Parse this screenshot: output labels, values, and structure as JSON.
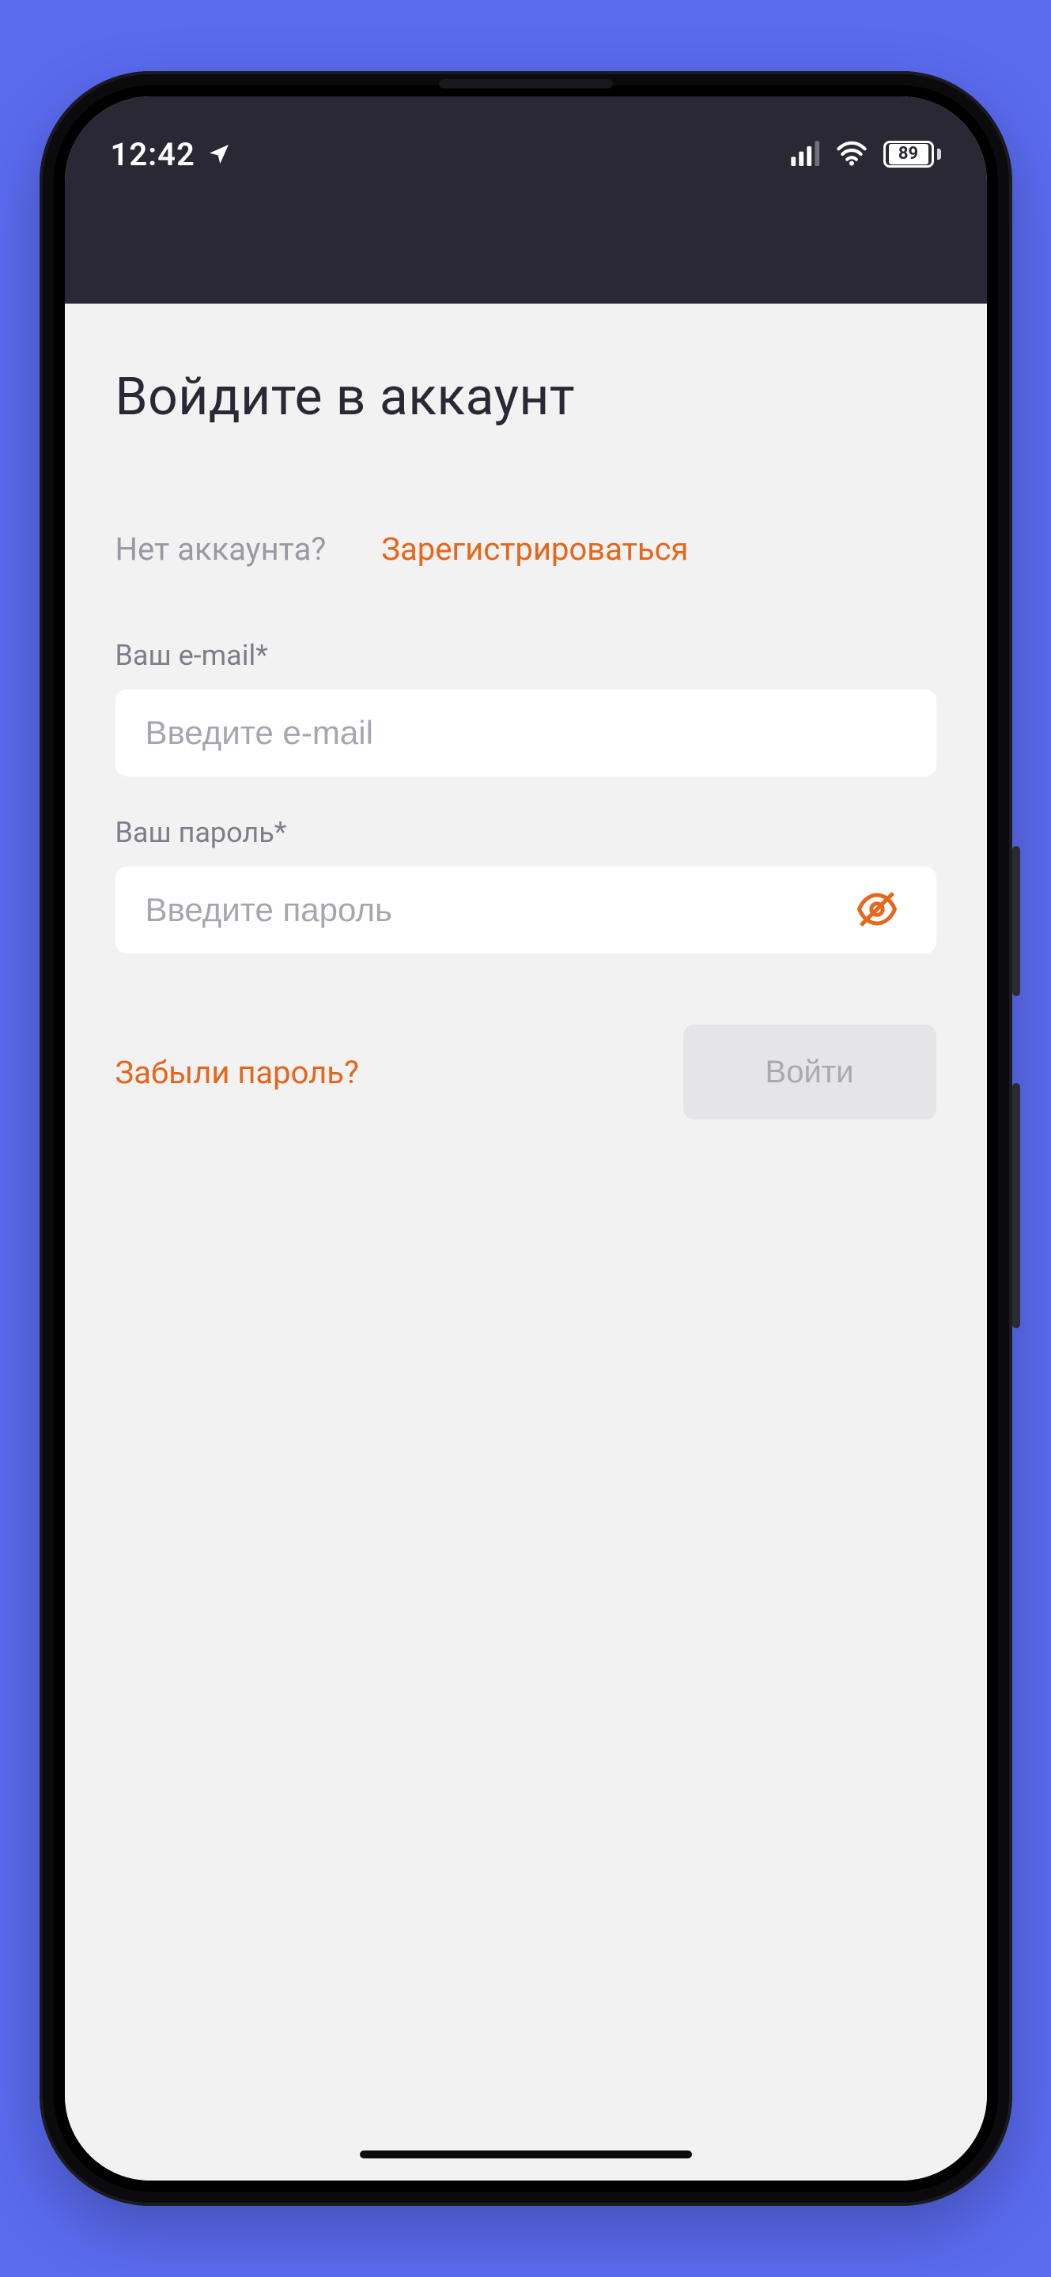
{
  "colors": {
    "accent": "#e5661c",
    "top_bar": "#2a2834",
    "bg": "#f2f2f2",
    "page_bg": "#5a6bf0"
  },
  "status_bar": {
    "time": "12:42",
    "location_icon": "location-arrow-icon",
    "signal_icon": "signal-icon",
    "wifi_icon": "wifi-icon",
    "battery_percent": "89"
  },
  "login": {
    "title": "Войдите в аккаунт",
    "no_account_label": "Нет аккаунта?",
    "register_label": "Зарегистрироваться",
    "email": {
      "label": "Ваш e-mail*",
      "placeholder": "Введите e-mail",
      "value": ""
    },
    "password": {
      "label": "Ваш пароль*",
      "placeholder": "Введите пароль",
      "value": "",
      "visibility_icon": "eye-off-icon"
    },
    "forgot_label": "Забыли пароль?",
    "submit_label": "Войти"
  }
}
